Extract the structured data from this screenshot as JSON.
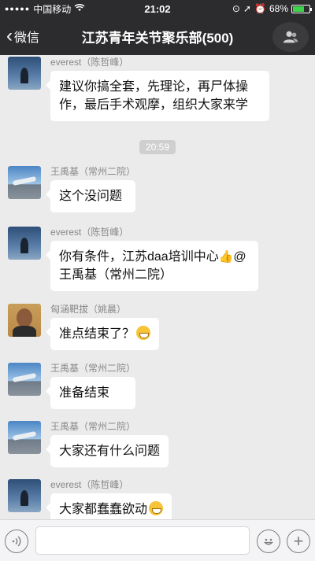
{
  "status_bar": {
    "signal": "●●●●●",
    "carrier": "中国移动",
    "time": "21:02",
    "battery": "68%",
    "battery_level": 0.68
  },
  "nav": {
    "back_label": "微信",
    "title": "江苏青年关节聚乐部(500)"
  },
  "messages": [
    {
      "sender": "everest（陈哲峰）",
      "avatar": "wolf",
      "text": "建议你搞全套，先理论，再尸体操作，最后手术观摩，组织大家来学"
    },
    {
      "sender": "王禹基（常州二院）",
      "avatar": "plane",
      "text": "这个没问题"
    },
    {
      "sender": "everest（陈哲峰）",
      "avatar": "wolf",
      "text": "你有条件，江苏daa培训中心",
      "mention": "@王禹基（常州二院）"
    },
    {
      "sender": "匈涵靶拔（姚晨）",
      "avatar": "person",
      "text": "准点结束了？"
    },
    {
      "sender": "王禹基（常州二院）",
      "avatar": "plane",
      "text": "准备结束"
    },
    {
      "sender": "王禹基（常州二院）",
      "avatar": "plane",
      "text": "大家还有什么问题"
    },
    {
      "sender": "everest（陈哲峰）",
      "avatar": "wolf",
      "text": "大家都蠢蠢欲动"
    }
  ],
  "timestamp": "20:59",
  "input_bar": {
    "text_value": "",
    "icons": [
      "voice-icon",
      "emoji-icon",
      "plus-icon"
    ]
  },
  "colors": {
    "bar_bg": "#2c2c2f",
    "chat_bg": "#ebebeb",
    "battery_fill": "#3fd34b"
  }
}
